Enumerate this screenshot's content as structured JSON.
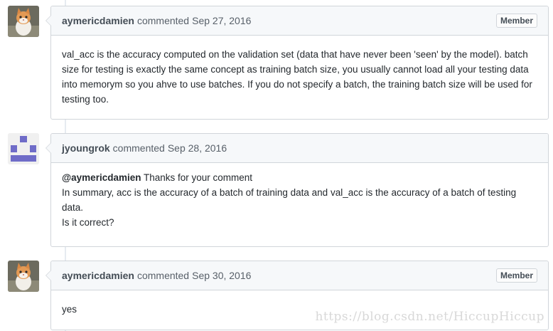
{
  "comments": [
    {
      "author": "aymericdamien",
      "action": "commented",
      "timestamp": "Sep 27, 2016",
      "badge": "Member",
      "avatar_icon": "kitten-avatar",
      "body": "val_acc is the accuracy computed on the validation set (data that have never been 'seen' by the model). batch size for testing is exactly the same concept as training batch size, you usually cannot load all your testing data into memorym so you ahve to use batches. If you do not specify a batch, the training batch size will be used for testing too."
    },
    {
      "author": "jyoungrok",
      "action": "commented",
      "timestamp": "Sep 28, 2016",
      "avatar_icon": "identicon-avatar",
      "avatar_color": "#6f6cc8",
      "mention": "@aymericdamien",
      "line1_rest": " Thanks for your comment",
      "line2": "In summary, acc is the accuracy of a batch of training data and val_acc is the accuracy of a batch of testing data.",
      "line3": "Is it correct?"
    },
    {
      "author": "aymericdamien",
      "action": "commented",
      "timestamp": "Sep 30, 2016",
      "badge": "Member",
      "avatar_icon": "kitten-avatar",
      "body": "yes"
    }
  ],
  "watermark": "https://blog.csdn.net/HiccupHiccup"
}
